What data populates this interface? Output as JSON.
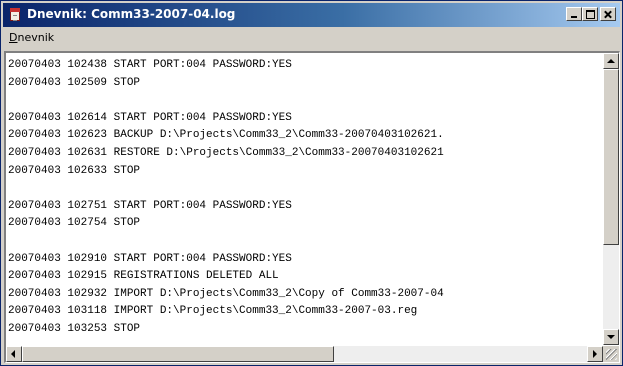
{
  "window": {
    "title": "Dnevnik: Comm33-2007-04.log"
  },
  "menubar": {
    "items": [
      {
        "label": "Dnevnik",
        "accelerator": "D"
      }
    ]
  },
  "log": {
    "lines": [
      "20070403 102438 START PORT:004 PASSWORD:YES",
      "20070403 102509 STOP",
      "",
      "20070403 102614 START PORT:004 PASSWORD:YES",
      "20070403 102623 BACKUP D:\\Projects\\Comm33_2\\Comm33-20070403102621.",
      "20070403 102631 RESTORE D:\\Projects\\Comm33_2\\Comm33-20070403102621",
      "20070403 102633 STOP",
      "",
      "20070403 102751 START PORT:004 PASSWORD:YES",
      "20070403 102754 STOP",
      "",
      "20070403 102910 START PORT:004 PASSWORD:YES",
      "20070403 102915 REGISTRATIONS DELETED ALL",
      "20070403 102932 IMPORT D:\\Projects\\Comm33_2\\Copy of Comm33-2007-04",
      "20070403 103118 IMPORT D:\\Projects\\Comm33_2\\Comm33-2007-03.reg",
      "20070403 103253 STOP"
    ]
  },
  "scroll": {
    "vertical_position": 0.0,
    "horizontal_position": 0.0
  },
  "icons": {
    "app": "log-document-icon",
    "minimize": "minimize-icon",
    "maximize": "maximize-icon",
    "close": "close-icon"
  }
}
